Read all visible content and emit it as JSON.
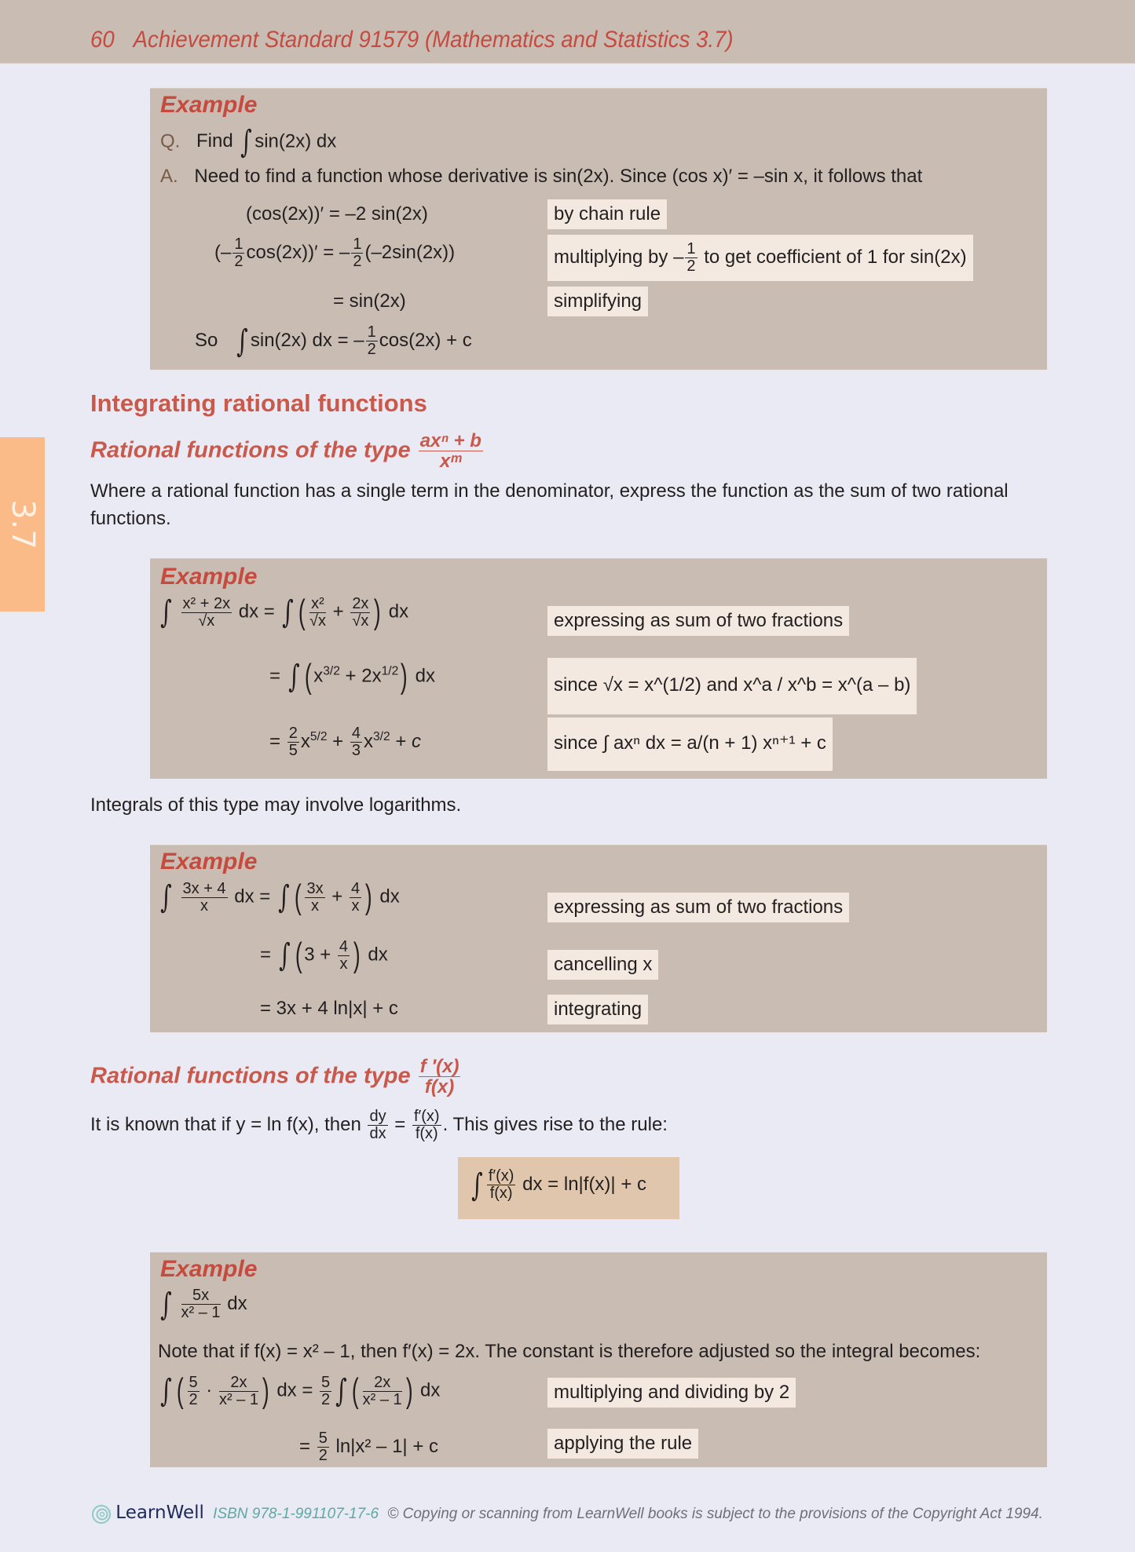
{
  "header": {
    "page_number": "60",
    "title": "Achievement Standard 91579 (Mathematics and Statistics 3.7)"
  },
  "side_tab": {
    "label": "3.7"
  },
  "example1": {
    "title": "Example",
    "q_label": "Q.",
    "q_text": "Find",
    "q_expr": "sin(2x) dx",
    "a_label": "A.",
    "a_text": "Need to find a function whose derivative is sin(2x). Since (cos x)′ = –sin x, it follows that",
    "step1": "(cos(2x))′ = –2 sin(2x)",
    "step2_left_pre": "(–",
    "step2_left_post": "cos(2x))′ = –",
    "step2_right": "(–2sin(2x))",
    "step3": "= sin(2x)",
    "so_label": "So",
    "so_expr": "sin(2x) dx = –",
    "so_tail": "cos(2x) + c",
    "half_num": "1",
    "half_den": "2",
    "notes": {
      "n1": "by chain rule",
      "n2_pre": "multiplying by –",
      "n2_post": "to get coefficient of 1 for sin(2x)",
      "n3": "simplifying"
    }
  },
  "section": {
    "heading": "Integrating rational functions",
    "sub1_text": "Rational functions of the type",
    "sub1_num": "axⁿ + b",
    "sub1_den": "xᵐ",
    "para1": "Where a rational function has a single term in the denominator, express the function as the sum of two rational functions.",
    "para2": "Integrals of this type may involve logarithms.",
    "sub2_text": "Rational functions of the type",
    "sub2_num": "f ′(x)",
    "sub2_den": "f(x)",
    "para3_pre": "It is known that if y = ln f(x), then",
    "para3_dy": "dy",
    "para3_dx": "dx",
    "para3_fnum": "f′(x)",
    "para3_fden": "f(x)",
    "para3_post": ". This gives rise to the rule:",
    "rule_tail": "dx = ln|f(x)| + c"
  },
  "example2": {
    "title": "Example",
    "l1_num": "x² + 2x",
    "l1_den": "√x",
    "l1_mid": "dx =",
    "l1_a_num": "x²",
    "l1_a_den": "√x",
    "l1_b_num": "2x",
    "l1_b_den": "√x",
    "dx": "dx",
    "l2": "x^(3/2) + 2x^(1/2)",
    "l3": "= 2/5 x^(5/2) + 4/3 x^(3/2) + c",
    "notes": {
      "n1": "expressing as sum of two fractions",
      "n2": "since √x = x^(1/2) and x^a / x^b = x^(a – b)",
      "n3": "since ∫ axⁿ dx = a/(n + 1) xⁿ⁺¹ + c"
    }
  },
  "example3": {
    "title": "Example",
    "l1_num": "3x + 4",
    "l1_den": "x",
    "l1_a_num": "3x",
    "l1_b_num": "4",
    "l1_den_x": "x",
    "dx": "dx",
    "l2_three": "3 +",
    "l3": "= 3x + 4 ln|x| + c",
    "notes": {
      "n1": "expressing as sum of two fractions",
      "n2": "cancelling x",
      "n3": "integrating"
    }
  },
  "example4": {
    "title": "Example",
    "l1_num": "5x",
    "l1_den": "x² – 1",
    "dx": "dx",
    "note_text": "Note that if f(x) = x² – 1, then f′(x) = 2x. The constant is therefore adjusted so the integral becomes:",
    "five": "5",
    "two": "2",
    "twox": "2x",
    "l3_tail": "ln|x² – 1| + c",
    "notes": {
      "n1": "multiplying and dividing by 2",
      "n2": "applying the rule"
    }
  },
  "footer": {
    "brand": "LearnWell",
    "isbn": "ISBN 978-1-991107-17-6",
    "copyright": "© Copying or scanning from LearnWell books is subject to the provisions of the Copyright Act 1994."
  }
}
